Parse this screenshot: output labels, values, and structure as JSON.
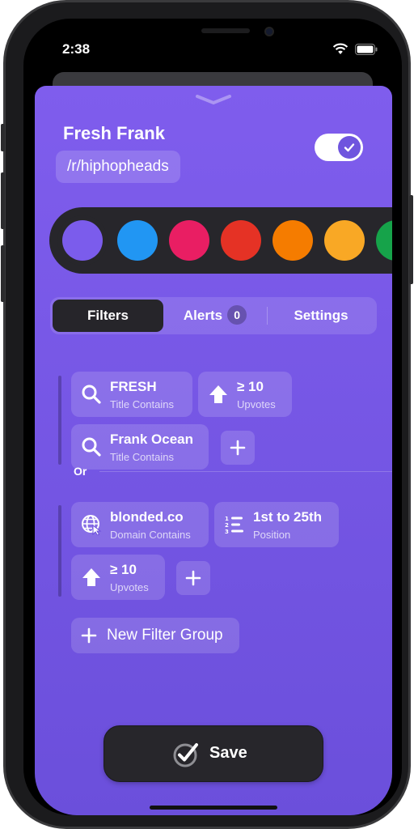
{
  "status": {
    "time": "2:38"
  },
  "header": {
    "title": "Fresh Frank",
    "subreddit": "/r/hiphopheads",
    "enabled": true
  },
  "colors": {
    "selected": "#7b5cec",
    "swatches": [
      "#7b5cec",
      "#2196f3",
      "#e91e63",
      "#e53225",
      "#f57c00",
      "#f9a825",
      "#16a34a"
    ]
  },
  "tabs": [
    {
      "label": "Filters",
      "active": true
    },
    {
      "label": "Alerts",
      "badge": "0",
      "active": false
    },
    {
      "label": "Settings",
      "active": false
    }
  ],
  "groups": [
    {
      "filters": [
        {
          "icon": "search-icon",
          "title": "FRESH",
          "subtitle": "Title Contains"
        },
        {
          "icon": "upvote-arrow-icon",
          "title": "≥ 10",
          "subtitle": "Upvotes"
        },
        {
          "icon": "search-icon",
          "title": "Frank Ocean",
          "subtitle": "Title Contains"
        }
      ]
    },
    {
      "filters": [
        {
          "icon": "globe-cursor-icon",
          "title": "blonded.co",
          "subtitle": "Domain Contains"
        },
        {
          "icon": "numbered-list-icon",
          "title": "1st to 25th",
          "subtitle": "Position"
        },
        {
          "icon": "upvote-arrow-icon",
          "title": "≥ 10",
          "subtitle": "Upvotes"
        }
      ]
    }
  ],
  "or_label": "Or",
  "new_group_label": "New Filter Group",
  "save_label": "Save"
}
